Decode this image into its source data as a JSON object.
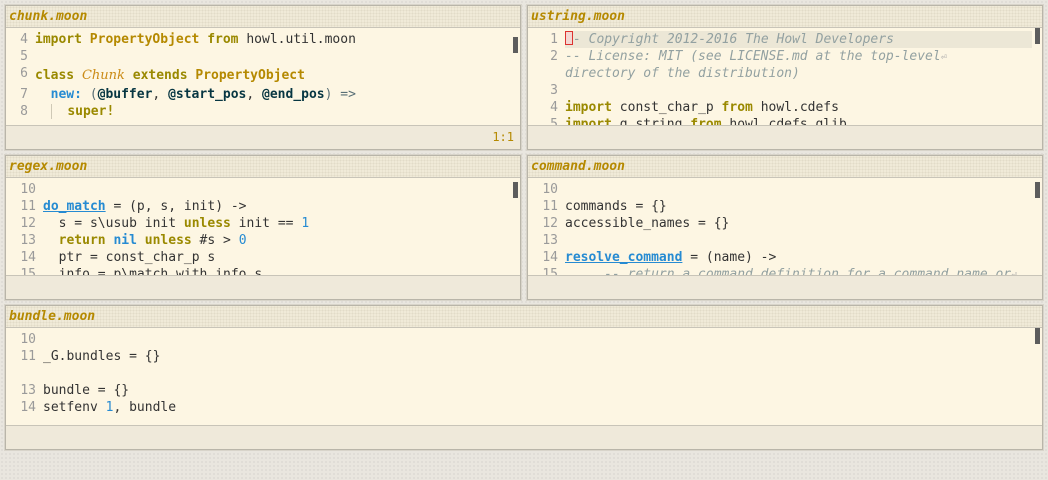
{
  "panes": [
    {
      "title": "chunk.moon",
      "status": "1:1"
    },
    {
      "title": "ustring.moon",
      "status": ""
    },
    {
      "title": "regex.moon",
      "status": ""
    },
    {
      "title": "command.moon",
      "status": ""
    },
    {
      "title": "bundle.moon",
      "status": ""
    }
  ],
  "chunk": {
    "gutter": [
      "4",
      "5",
      "6",
      "7",
      "8"
    ],
    "l1": {
      "a": "import",
      "b": "PropertyObject",
      "c": "from",
      "d": "howl.util.moon"
    },
    "l3": {
      "a": "class",
      "b": "Chunk",
      "c": "extends",
      "d": "PropertyObject"
    },
    "l4": {
      "a": "new:",
      "b": "(",
      "c": "@buffer",
      ",1": ",",
      "d": "@start_pos",
      ",2": ",",
      "e": "@end_pos",
      "f": ")",
      "g": "=>"
    },
    "l5": {
      "a": "super!"
    }
  },
  "ustring": {
    "gutter": [
      "1",
      "2",
      "",
      "3",
      "4",
      "5"
    ],
    "l1": "- Copyright 2012-2016 The Howl Developers",
    "l2a": "-- License: MIT (see LICENSE.md at the top-level",
    "l2b": "directory of the distribution)",
    "l4": {
      "a": "import",
      "b": "const_char_p",
      "c": "from",
      "d": "howl.cdefs"
    },
    "l5": {
      "a": "import",
      "b": "g_string",
      "c": "from",
      "d": "howl.cdefs.glib"
    },
    "wrap": "⏎"
  },
  "regex": {
    "gutter": [
      "10",
      "11",
      "12",
      "13",
      "14",
      "15"
    ],
    "l2": {
      "a": "do_match",
      "b": " = (p, s, init) ->"
    },
    "l3": {
      "a": "s = s\\usub init ",
      "b": "unless",
      "c": " init == ",
      "d": "1"
    },
    "l4": {
      "a": "return",
      "b": "nil",
      "c": "unless",
      "d": " #s > ",
      "e": "0"
    },
    "l5": "ptr = const_char_p s",
    "l6": "info = p\\match_with_info s"
  },
  "command": {
    "gutter": [
      "10",
      "11",
      "12",
      "13",
      "14",
      "15"
    ],
    "l2": "commands = {}",
    "l3": "accessible_names = {}",
    "l5": {
      "a": "resolve_command",
      "b": " = (name) ->"
    },
    "l6": "-- return a command definition for a command name or",
    "wrap": "⏎"
  },
  "bundle": {
    "gutter": [
      "10",
      "11",
      "12",
      "13",
      "14"
    ],
    "l2": "_G.bundles = {}",
    "l4": "bundle = {}",
    "l5": {
      "a": "setfenv ",
      "b": "1",
      "c": ", bundle"
    }
  }
}
